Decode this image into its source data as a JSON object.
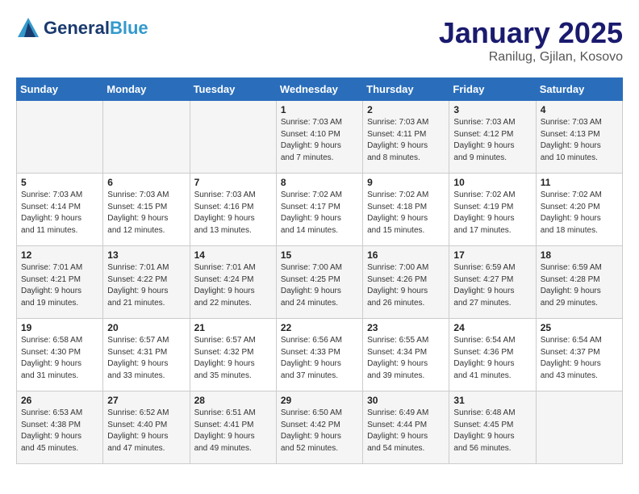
{
  "header": {
    "logo_general": "General",
    "logo_blue": "Blue",
    "title": "January 2025",
    "subtitle": "Ranilug, Gjilan, Kosovo"
  },
  "days_of_week": [
    "Sunday",
    "Monday",
    "Tuesday",
    "Wednesday",
    "Thursday",
    "Friday",
    "Saturday"
  ],
  "weeks": [
    [
      {
        "day": "",
        "detail": ""
      },
      {
        "day": "",
        "detail": ""
      },
      {
        "day": "",
        "detail": ""
      },
      {
        "day": "1",
        "detail": "Sunrise: 7:03 AM\nSunset: 4:10 PM\nDaylight: 9 hours\nand 7 minutes."
      },
      {
        "day": "2",
        "detail": "Sunrise: 7:03 AM\nSunset: 4:11 PM\nDaylight: 9 hours\nand 8 minutes."
      },
      {
        "day": "3",
        "detail": "Sunrise: 7:03 AM\nSunset: 4:12 PM\nDaylight: 9 hours\nand 9 minutes."
      },
      {
        "day": "4",
        "detail": "Sunrise: 7:03 AM\nSunset: 4:13 PM\nDaylight: 9 hours\nand 10 minutes."
      }
    ],
    [
      {
        "day": "5",
        "detail": "Sunrise: 7:03 AM\nSunset: 4:14 PM\nDaylight: 9 hours\nand 11 minutes."
      },
      {
        "day": "6",
        "detail": "Sunrise: 7:03 AM\nSunset: 4:15 PM\nDaylight: 9 hours\nand 12 minutes."
      },
      {
        "day": "7",
        "detail": "Sunrise: 7:03 AM\nSunset: 4:16 PM\nDaylight: 9 hours\nand 13 minutes."
      },
      {
        "day": "8",
        "detail": "Sunrise: 7:02 AM\nSunset: 4:17 PM\nDaylight: 9 hours\nand 14 minutes."
      },
      {
        "day": "9",
        "detail": "Sunrise: 7:02 AM\nSunset: 4:18 PM\nDaylight: 9 hours\nand 15 minutes."
      },
      {
        "day": "10",
        "detail": "Sunrise: 7:02 AM\nSunset: 4:19 PM\nDaylight: 9 hours\nand 17 minutes."
      },
      {
        "day": "11",
        "detail": "Sunrise: 7:02 AM\nSunset: 4:20 PM\nDaylight: 9 hours\nand 18 minutes."
      }
    ],
    [
      {
        "day": "12",
        "detail": "Sunrise: 7:01 AM\nSunset: 4:21 PM\nDaylight: 9 hours\nand 19 minutes."
      },
      {
        "day": "13",
        "detail": "Sunrise: 7:01 AM\nSunset: 4:22 PM\nDaylight: 9 hours\nand 21 minutes."
      },
      {
        "day": "14",
        "detail": "Sunrise: 7:01 AM\nSunset: 4:24 PM\nDaylight: 9 hours\nand 22 minutes."
      },
      {
        "day": "15",
        "detail": "Sunrise: 7:00 AM\nSunset: 4:25 PM\nDaylight: 9 hours\nand 24 minutes."
      },
      {
        "day": "16",
        "detail": "Sunrise: 7:00 AM\nSunset: 4:26 PM\nDaylight: 9 hours\nand 26 minutes."
      },
      {
        "day": "17",
        "detail": "Sunrise: 6:59 AM\nSunset: 4:27 PM\nDaylight: 9 hours\nand 27 minutes."
      },
      {
        "day": "18",
        "detail": "Sunrise: 6:59 AM\nSunset: 4:28 PM\nDaylight: 9 hours\nand 29 minutes."
      }
    ],
    [
      {
        "day": "19",
        "detail": "Sunrise: 6:58 AM\nSunset: 4:30 PM\nDaylight: 9 hours\nand 31 minutes."
      },
      {
        "day": "20",
        "detail": "Sunrise: 6:57 AM\nSunset: 4:31 PM\nDaylight: 9 hours\nand 33 minutes."
      },
      {
        "day": "21",
        "detail": "Sunrise: 6:57 AM\nSunset: 4:32 PM\nDaylight: 9 hours\nand 35 minutes."
      },
      {
        "day": "22",
        "detail": "Sunrise: 6:56 AM\nSunset: 4:33 PM\nDaylight: 9 hours\nand 37 minutes."
      },
      {
        "day": "23",
        "detail": "Sunrise: 6:55 AM\nSunset: 4:34 PM\nDaylight: 9 hours\nand 39 minutes."
      },
      {
        "day": "24",
        "detail": "Sunrise: 6:54 AM\nSunset: 4:36 PM\nDaylight: 9 hours\nand 41 minutes."
      },
      {
        "day": "25",
        "detail": "Sunrise: 6:54 AM\nSunset: 4:37 PM\nDaylight: 9 hours\nand 43 minutes."
      }
    ],
    [
      {
        "day": "26",
        "detail": "Sunrise: 6:53 AM\nSunset: 4:38 PM\nDaylight: 9 hours\nand 45 minutes."
      },
      {
        "day": "27",
        "detail": "Sunrise: 6:52 AM\nSunset: 4:40 PM\nDaylight: 9 hours\nand 47 minutes."
      },
      {
        "day": "28",
        "detail": "Sunrise: 6:51 AM\nSunset: 4:41 PM\nDaylight: 9 hours\nand 49 minutes."
      },
      {
        "day": "29",
        "detail": "Sunrise: 6:50 AM\nSunset: 4:42 PM\nDaylight: 9 hours\nand 52 minutes."
      },
      {
        "day": "30",
        "detail": "Sunrise: 6:49 AM\nSunset: 4:44 PM\nDaylight: 9 hours\nand 54 minutes."
      },
      {
        "day": "31",
        "detail": "Sunrise: 6:48 AM\nSunset: 4:45 PM\nDaylight: 9 hours\nand 56 minutes."
      },
      {
        "day": "",
        "detail": ""
      }
    ]
  ]
}
